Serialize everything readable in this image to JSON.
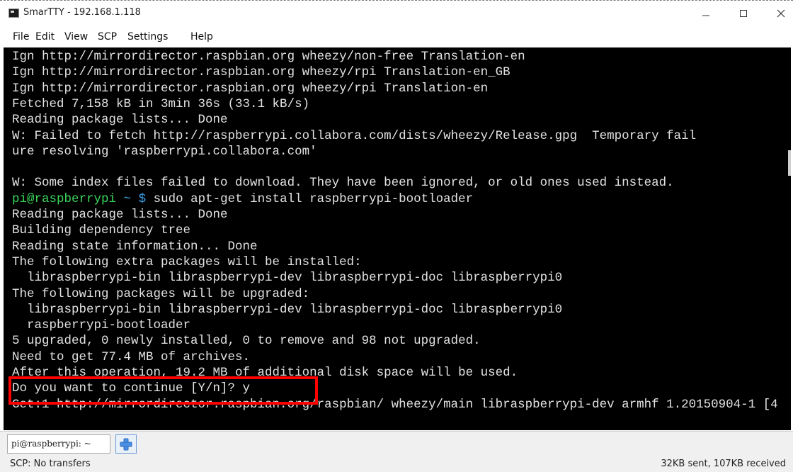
{
  "window": {
    "title": "SmarTTY - 192.168.1.118",
    "minimize_glyph": "—",
    "close_glyph": "✕"
  },
  "menu": {
    "file": "File",
    "edit": "Edit",
    "view": "View",
    "scp": "SCP",
    "settings": "Settings",
    "help": "Help"
  },
  "terminal": {
    "lines": [
      "Ign http://mirrordirector.raspbian.org wheezy/non-free Translation-en",
      "Ign http://mirrordirector.raspbian.org wheezy/rpi Translation-en_GB",
      "Ign http://mirrordirector.raspbian.org wheezy/rpi Translation-en",
      "Fetched 7,158 kB in 3min 36s (33.1 kB/s)",
      "Reading package lists... Done",
      "W: Failed to fetch http://raspberrypi.collabora.com/dists/wheezy/Release.gpg  Temporary fail",
      "ure resolving 'raspberrypi.collabora.com'",
      "",
      "W: Some index files failed to download. They have been ignored, or old ones used instead."
    ],
    "prompt": {
      "user_host": "pi@raspberrypi",
      "path": "~",
      "symbol": "$",
      "command": "sudo apt-get install raspberrypi-bootloader"
    },
    "output": [
      "Reading package lists... Done",
      "Building dependency tree",
      "Reading state information... Done",
      "The following extra packages will be installed:",
      "  libraspberrypi-bin libraspberrypi-dev libraspberrypi-doc libraspberrypi0",
      "The following packages will be upgraded:",
      "  libraspberrypi-bin libraspberrypi-dev libraspberrypi-doc libraspberrypi0",
      "  raspberrypi-bootloader",
      "5 upgraded, 0 newly installed, 0 to remove and 98 not upgraded.",
      "Need to get 77.4 MB of archives.",
      "After this operation, 19.2 MB of additional disk space will be used.",
      "Do you want to continue [Y/n]? y",
      "Get:1 http://mirrordirector.raspbian.org/raspbian/ wheezy/main libraspberrypi-dev armhf 1.20150904-1 [4"
    ]
  },
  "tabs": [
    {
      "label": "pi@raspberrypi: ~"
    }
  ],
  "add_tab_icon": "plus-icon",
  "status": {
    "left": "SCP: No transfers",
    "right": "32KB sent, 107KB received"
  },
  "colors": {
    "terminal_bg": "#000000",
    "terminal_fg": "#e2e2e2",
    "prompt_user": "#3bd75a",
    "prompt_path": "#3aa0e8",
    "highlight_box": "#ff0000"
  }
}
